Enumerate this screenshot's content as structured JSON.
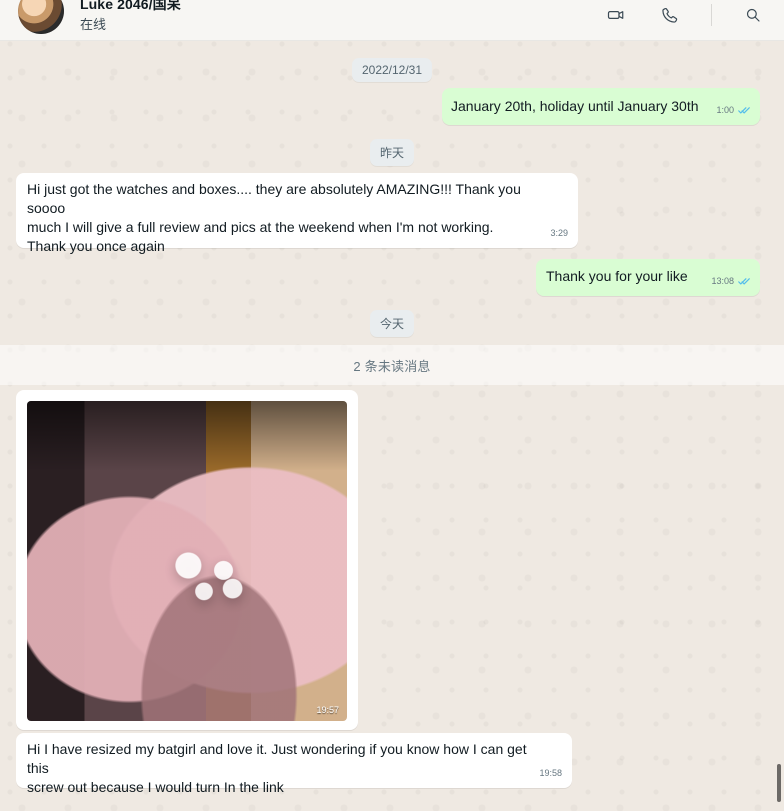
{
  "header": {
    "contact_name": "Luke 2046/国呆",
    "status": "在线"
  },
  "actions": {
    "video_call": "video-call",
    "voice_call": "voice-call",
    "search": "search"
  },
  "chat": {
    "dividers": [
      "2022/12/31",
      "昨天",
      "今天"
    ],
    "unread_banner": "2 条未读消息",
    "messages": [
      {
        "direction": "out",
        "text": "January 20th, holiday until January 30th",
        "time": "1:00",
        "ticks": "double"
      },
      {
        "direction": "in",
        "text": "Hi just got the watches and boxes.... they are absolutely AMAZING!!! Thank you soooo\nmuch I will give a full review and pics at the weekend when I'm not working.\nThank you once again",
        "time": "3:29"
      },
      {
        "direction": "out",
        "text": "Thank you for your like",
        "time": "13:08",
        "ticks": "double"
      },
      {
        "direction": "in",
        "type": "image",
        "time": "19:57"
      },
      {
        "direction": "in",
        "text": "Hi I have resized my batgirl and love it. Just wondering if you know how I can get this\nscrew out because I would turn In the link",
        "time": "19:58"
      }
    ]
  },
  "colors": {
    "incoming_bubble": "#ffffff",
    "outgoing_bubble": "#d9fdd3",
    "tick_blue": "#53bdeb"
  }
}
